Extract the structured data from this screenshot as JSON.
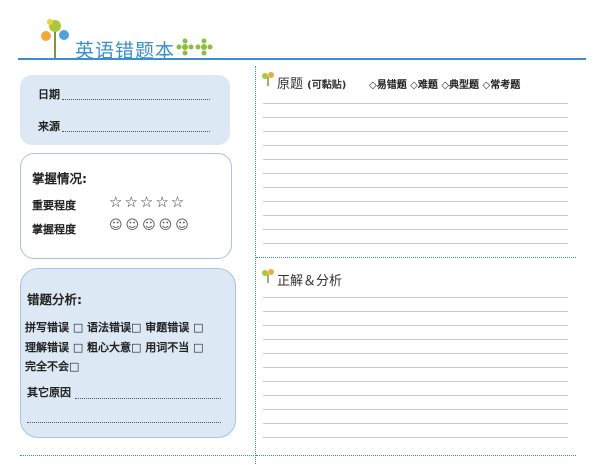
{
  "header": {
    "title": "英语错题本",
    "accent": "#3a8fcf"
  },
  "info": {
    "date_label": "日期",
    "source_label": "来源"
  },
  "mastery": {
    "title": "掌握情况:",
    "importance_label": "重要程度",
    "importance_value": "☆☆☆☆☆",
    "mastery_label": "掌握程度",
    "mastery_value": "☺☺☺☺☺"
  },
  "analysis": {
    "title": "错题分析:",
    "row1": "拼写错误 □ 语法错误□ 审题错误 □",
    "row2": "理解错误 □ 粗心大意□ 用词不当 □",
    "row3": "完全不会□",
    "other_label": "其它原因"
  },
  "original": {
    "title": "原题",
    "subtitle": "(可黏贴)",
    "options": "◇易错题 ◇难题 ◇典型题 ◇常考题"
  },
  "solution": {
    "title": "正解＆分析"
  }
}
